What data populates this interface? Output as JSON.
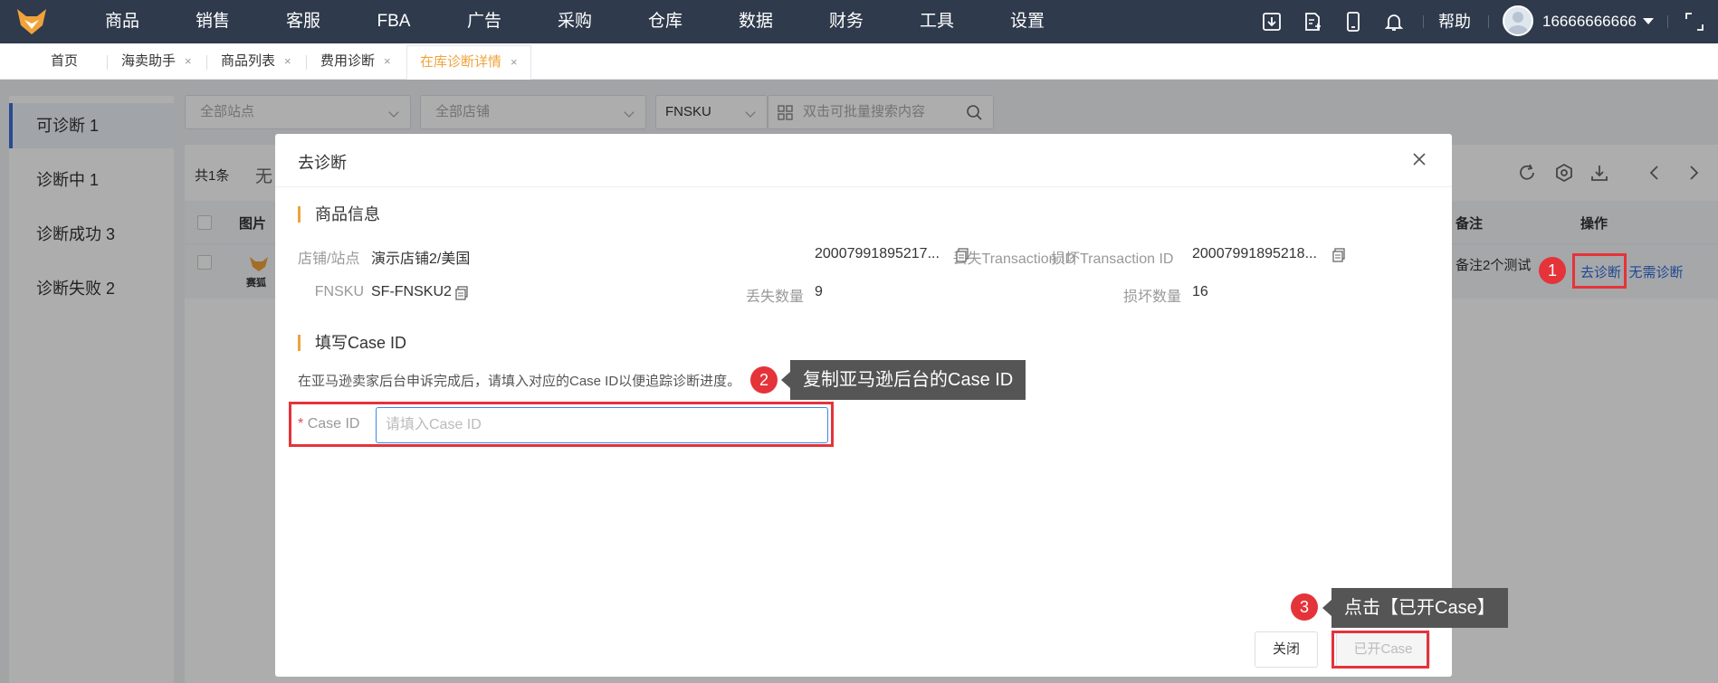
{
  "topnav": {
    "items": [
      "商品",
      "销售",
      "客服",
      "FBA",
      "广告",
      "采购",
      "仓库",
      "数据",
      "财务",
      "工具",
      "设置"
    ],
    "help": "帮助",
    "username": "16666666666"
  },
  "tabs": [
    {
      "label": "首页"
    },
    {
      "label": "海卖助手",
      "close": "×"
    },
    {
      "label": "商品列表",
      "close": "×"
    },
    {
      "label": "费用诊断",
      "close": "×"
    },
    {
      "label": "在库诊断详情",
      "close": "×"
    }
  ],
  "sidebar": {
    "items": [
      {
        "label": "可诊断 1"
      },
      {
        "label": "诊断中 1"
      },
      {
        "label": "诊断成功 3"
      },
      {
        "label": "诊断失败 2"
      }
    ]
  },
  "filters": {
    "site": "全部站点",
    "shop": "全部店铺",
    "field": "FNSKU",
    "search_placeholder": "双击可批量搜索内容"
  },
  "list": {
    "count": "共1条",
    "none_partial": "无",
    "col_image": "图片",
    "col_note": "备注",
    "col_action": "操作",
    "row_brand": "赛狐",
    "row_note": "备注2个测试",
    "action_diagnose": "去诊断",
    "action_no_need": "无需诊断"
  },
  "modal": {
    "title": "去诊断",
    "section_product": "商品信息",
    "shop_label": "店铺/站点",
    "shop_value": "演示店铺2/美国",
    "lost_tid_label": "丢失Transaction ID",
    "lost_tid_value": "20007991895217...",
    "damaged_tid_label": "损坏Transaction ID",
    "damaged_tid_value": "20007991895218...",
    "fnsku_label": "FNSKU",
    "fnsku_value": "SF-FNSKU2",
    "lost_qty_label": "丢失数量",
    "lost_qty_value": "9",
    "damaged_qty_label": "损坏数量",
    "damaged_qty_value": "16",
    "section_case": "填写Case ID",
    "hint": "在亚马逊卖家后台申诉完成后，请填入对应的Case ID以便追踪诊断进度。",
    "case_label_star": "*",
    "case_label": "Case ID",
    "case_placeholder": "请填入Case ID",
    "case_value": "",
    "btn_close": "关闭",
    "btn_opened": "已开Case"
  },
  "annotations": {
    "n1": "1",
    "n2": "2",
    "n3": "3",
    "tip2": "复制亚马逊后台的Case ID",
    "tip3": "点击【已开Case】",
    "accent": "#e5333a"
  }
}
